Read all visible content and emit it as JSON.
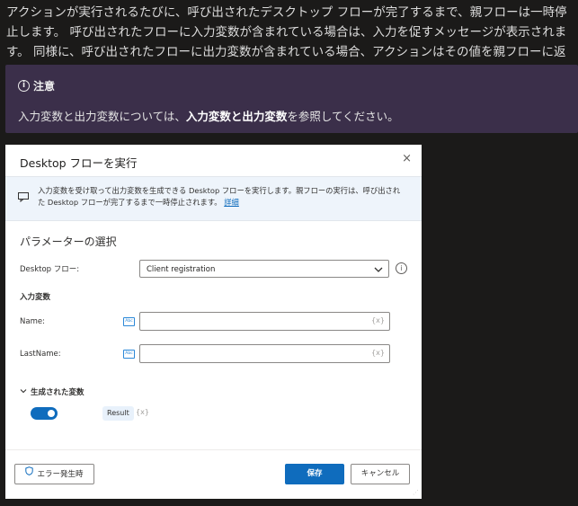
{
  "doc": {
    "intro": "アクションが実行されるたびに、呼び出されたデスクトップ フローが完了するまで、親フローは一時停止します。 呼び出されたフローに入力変数が含まれている場合は、入力を促すメッセージが表示されます。 同様に、呼び出されたフローに出力変数が含まれている場合、アクションはその値を親フローに返します。"
  },
  "note": {
    "title": "注意",
    "body_prefix": "入力変数と出力変数については、",
    "body_bold": "入力変数と出力変数",
    "body_suffix": "を参照してください。"
  },
  "dialog": {
    "title": "Desktop フローを実行",
    "close_glyph": "×",
    "banner_text": "入力変数を受け取って出力変数を生成できる Desktop フローを実行します。親フローの実行は、呼び出された Desktop フローが完了するまで一時停止されます。",
    "banner_link": "詳細",
    "section_title": "パラメーターの選択",
    "flow_label": "Desktop フロー:",
    "flow_value": "Client registration",
    "input_vars_title": "入力変数",
    "name_label": "Name:",
    "lastname_label": "LastName:",
    "var_glyph": "{x}",
    "abc_text": "Abc",
    "generated_title": "生成された変数",
    "result_chip": "Result",
    "result_var_glyph": "{x}",
    "error_button": "エラー発生時",
    "save_button": "保存",
    "cancel_button": "キャンセル"
  },
  "colors": {
    "page_bg": "#1b1a19",
    "note_bg": "#3b2f4a",
    "accent": "#0f6cbd"
  },
  "icons": [
    "info-icon",
    "close-icon",
    "message-icon",
    "chevron-down-icon",
    "text-variable-icon",
    "chevron-collapse-icon",
    "shield-icon"
  ]
}
